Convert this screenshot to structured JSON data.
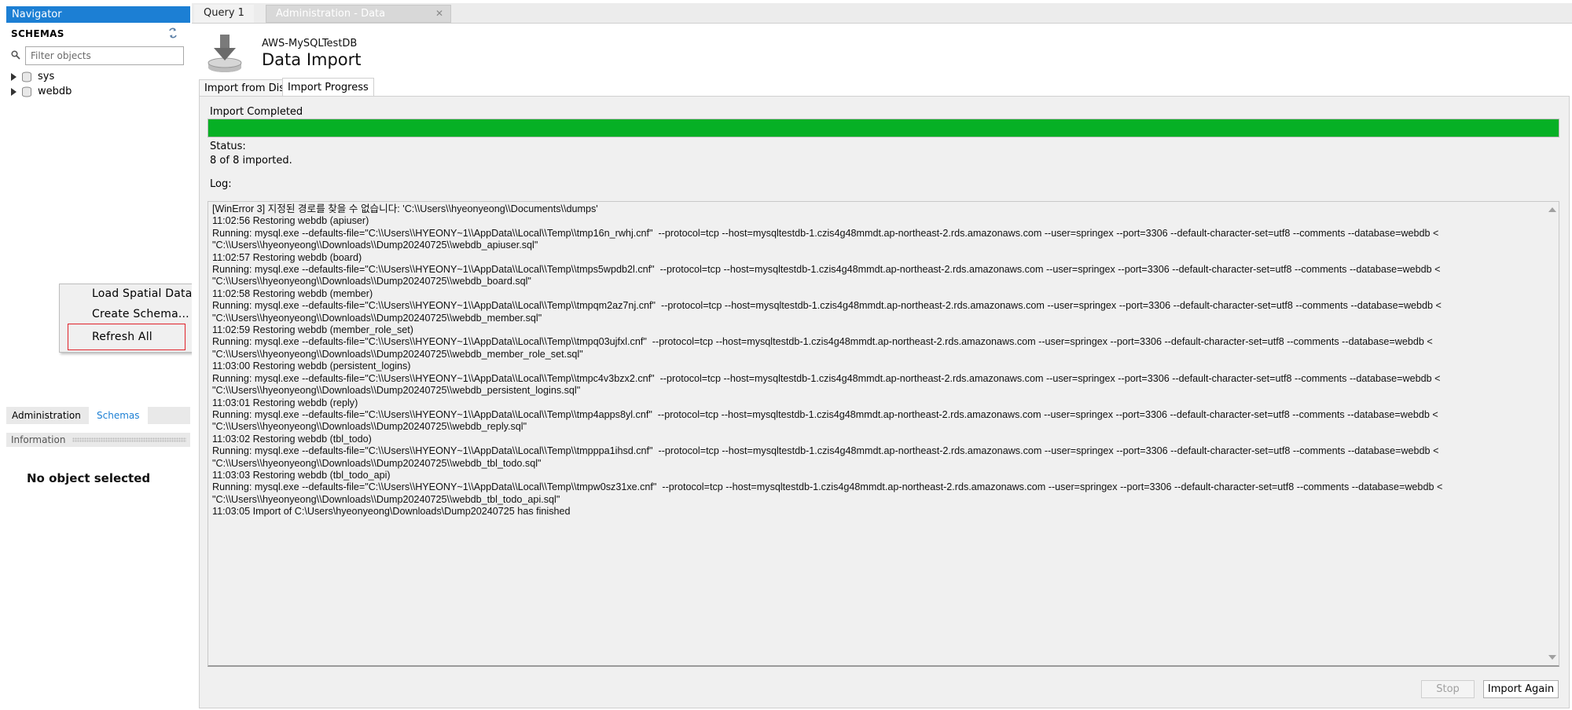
{
  "navigator": {
    "header": "Navigator",
    "schemas_title": "SCHEMAS",
    "filter_placeholder": "Filter objects",
    "schemas": [
      {
        "name": "sys"
      },
      {
        "name": "webdb"
      }
    ],
    "context_menu": {
      "items": [
        "Load Spatial Data",
        "Create Schema...",
        "Refresh All"
      ],
      "highlighted": "Refresh All"
    },
    "bottom_tabs": [
      "Administration",
      "Schemas"
    ],
    "active_bottom_tab": "Schemas",
    "information_header": "Information",
    "information_text": "No object selected"
  },
  "document_tabs": [
    {
      "label": "Query 1"
    },
    {
      "label": "Administration - Data Import/Res..."
    }
  ],
  "page": {
    "connection_name": "AWS-MySQLTestDB",
    "title": "Data Import",
    "sub_tabs": [
      "Import from Disk",
      "Import Progress"
    ],
    "active_sub_tab": "Import Progress"
  },
  "progress": {
    "title": "Import Completed",
    "fraction": 1.0,
    "color": "#06b025",
    "status_label": "Status:",
    "status_value": "8 of 8 imported.",
    "log_label": "Log:"
  },
  "log_lines": [
    "[WinError 3] 지정된 경로를 찾을 수 없습니다: 'C:\\\\Users\\\\hyeonyeong\\\\Documents\\\\dumps'",
    "11:02:56 Restoring webdb (apiuser)",
    "Running: mysql.exe --defaults-file=\"C:\\\\Users\\\\HYEONY~1\\\\AppData\\\\Local\\\\Temp\\\\tmp16n_rwhj.cnf\"  --protocol=tcp --host=mysqltestdb-1.czis4g48mmdt.ap-northeast-2.rds.amazonaws.com --user=springex --port=3306 --default-character-set=utf8 --comments --database=webdb <",
    "\"C:\\\\Users\\\\hyeonyeong\\\\Downloads\\\\Dump20240725\\\\webdb_apiuser.sql\"",
    "11:02:57 Restoring webdb (board)",
    "Running: mysql.exe --defaults-file=\"C:\\\\Users\\\\HYEONY~1\\\\AppData\\\\Local\\\\Temp\\\\tmps5wpdb2l.cnf\"  --protocol=tcp --host=mysqltestdb-1.czis4g48mmdt.ap-northeast-2.rds.amazonaws.com --user=springex --port=3306 --default-character-set=utf8 --comments --database=webdb <",
    "\"C:\\\\Users\\\\hyeonyeong\\\\Downloads\\\\Dump20240725\\\\webdb_board.sql\"",
    "11:02:58 Restoring webdb (member)",
    "Running: mysql.exe --defaults-file=\"C:\\\\Users\\\\HYEONY~1\\\\AppData\\\\Local\\\\Temp\\\\tmpqm2az7nj.cnf\"  --protocol=tcp --host=mysqltestdb-1.czis4g48mmdt.ap-northeast-2.rds.amazonaws.com --user=springex --port=3306 --default-character-set=utf8 --comments --database=webdb <",
    "\"C:\\\\Users\\\\hyeonyeong\\\\Downloads\\\\Dump20240725\\\\webdb_member.sql\"",
    "11:02:59 Restoring webdb (member_role_set)",
    "Running: mysql.exe --defaults-file=\"C:\\\\Users\\\\HYEONY~1\\\\AppData\\\\Local\\\\Temp\\\\tmpq03ujfxl.cnf\"  --protocol=tcp --host=mysqltestdb-1.czis4g48mmdt.ap-northeast-2.rds.amazonaws.com --user=springex --port=3306 --default-character-set=utf8 --comments --database=webdb <",
    "\"C:\\\\Users\\\\hyeonyeong\\\\Downloads\\\\Dump20240725\\\\webdb_member_role_set.sql\"",
    "11:03:00 Restoring webdb (persistent_logins)",
    "Running: mysql.exe --defaults-file=\"C:\\\\Users\\\\HYEONY~1\\\\AppData\\\\Local\\\\Temp\\\\tmpc4v3bzx2.cnf\"  --protocol=tcp --host=mysqltestdb-1.czis4g48mmdt.ap-northeast-2.rds.amazonaws.com --user=springex --port=3306 --default-character-set=utf8 --comments --database=webdb <",
    "\"C:\\\\Users\\\\hyeonyeong\\\\Downloads\\\\Dump20240725\\\\webdb_persistent_logins.sql\"",
    "11:03:01 Restoring webdb (reply)",
    "Running: mysql.exe --defaults-file=\"C:\\\\Users\\\\HYEONY~1\\\\AppData\\\\Local\\\\Temp\\\\tmp4apps8yl.cnf\"  --protocol=tcp --host=mysqltestdb-1.czis4g48mmdt.ap-northeast-2.rds.amazonaws.com --user=springex --port=3306 --default-character-set=utf8 --comments --database=webdb <",
    "\"C:\\\\Users\\\\hyeonyeong\\\\Downloads\\\\Dump20240725\\\\webdb_reply.sql\"",
    "11:03:02 Restoring webdb (tbl_todo)",
    "Running: mysql.exe --defaults-file=\"C:\\\\Users\\\\HYEONY~1\\\\AppData\\\\Local\\\\Temp\\\\tmpppa1ihsd.cnf\"  --protocol=tcp --host=mysqltestdb-1.czis4g48mmdt.ap-northeast-2.rds.amazonaws.com --user=springex --port=3306 --default-character-set=utf8 --comments --database=webdb <",
    "\"C:\\\\Users\\\\hyeonyeong\\\\Downloads\\\\Dump20240725\\\\webdb_tbl_todo.sql\"",
    "11:03:03 Restoring webdb (tbl_todo_api)",
    "Running: mysql.exe --defaults-file=\"C:\\\\Users\\\\HYEONY~1\\\\AppData\\\\Local\\\\Temp\\\\tmpw0sz31xe.cnf\"  --protocol=tcp --host=mysqltestdb-1.czis4g48mmdt.ap-northeast-2.rds.amazonaws.com --user=springex --port=3306 --default-character-set=utf8 --comments --database=webdb <",
    "\"C:\\\\Users\\\\hyeonyeong\\\\Downloads\\\\Dump20240725\\\\webdb_tbl_todo_api.sql\"",
    "11:03:05 Import of C:\\Users\\hyeonyeong\\Downloads\\Dump20240725 has finished"
  ],
  "buttons": {
    "stop": "Stop",
    "import_again": "Import Again"
  },
  "colors": {
    "navigator_header": "#1c7fd4",
    "progress_fill": "#06b025",
    "highlight_border": "#e0222a"
  }
}
